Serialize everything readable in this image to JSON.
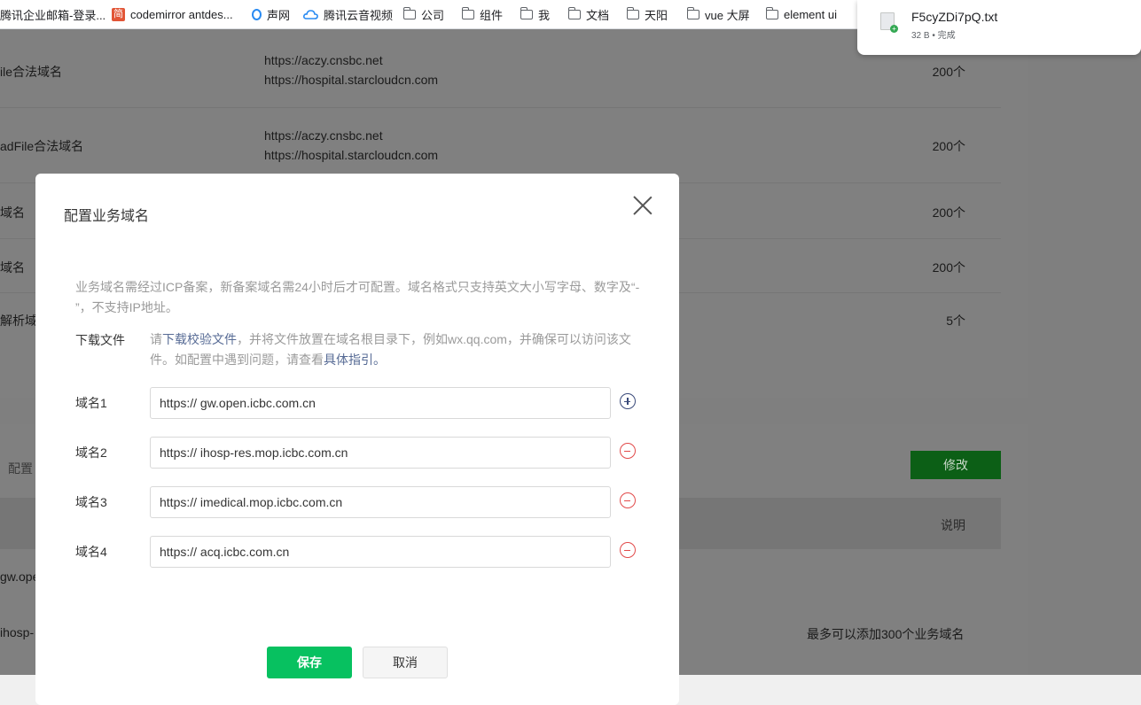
{
  "bookmarks": [
    {
      "label": "腾讯企业邮箱-登录...",
      "icon": "none"
    },
    {
      "label": "codemirror antdes...",
      "icon": "jian-icon"
    },
    {
      "label": "声网",
      "icon": "ring-icon"
    },
    {
      "label": "腾讯云音视频",
      "icon": "cloud-icon"
    },
    {
      "label": "公司",
      "icon": "folder-icon"
    },
    {
      "label": "组件",
      "icon": "folder-icon"
    },
    {
      "label": "我",
      "icon": "folder-icon"
    },
    {
      "label": "文档",
      "icon": "folder-icon"
    },
    {
      "label": "天阳",
      "icon": "folder-icon"
    },
    {
      "label": "vue 大屏",
      "icon": "folder-icon"
    },
    {
      "label": "element ui",
      "icon": "folder-icon"
    }
  ],
  "jian_char": "简",
  "download": {
    "filename": "F5cyZDi7pQ.txt",
    "meta": "32 B • 完成"
  },
  "background": {
    "rows": [
      {
        "label": "ile合法域名",
        "urls": [
          "https://aczy.cnsbc.net",
          "https://hospital.starcloudcn.com"
        ],
        "count": "200个"
      },
      {
        "label": "adFile合法域名",
        "urls": [
          "https://aczy.cnsbc.net",
          "https://hospital.starcloudcn.com"
        ],
        "count": "200个"
      },
      {
        "label": "域名",
        "urls": [],
        "count": "200个"
      },
      {
        "label": "域名",
        "urls": [],
        "count": "200个"
      },
      {
        "label": "解析域名",
        "urls": [],
        "count": "5个"
      }
    ],
    "config_label": "配置",
    "modify_label": "修改",
    "table_header": "说明",
    "cell1": "gw.ope",
    "cell2": "ihosp-",
    "max_note": "最多可以添加300个业务域名"
  },
  "modal": {
    "title": "配置业务域名",
    "notice": "业务域名需经过ICP备案，新备案域名需24小时后才可配置。域名格式只支持英文大小写字母、数字及“- ”，不支持IP地址。",
    "download_label": "下载文件",
    "download_desc_prefix": "请",
    "download_link": "下载校验文件",
    "download_desc_middle": "，并将文件放置在域名根目录下，例如wx.qq.com，并确保可以访问该文件。如配置中遇到问题，请查看",
    "guide_link": "具体指引",
    "download_desc_suffix": "。",
    "fields": [
      {
        "label": "域名1",
        "value": "https:// gw.open.icbc.com.cn",
        "action": "add"
      },
      {
        "label": "域名2",
        "value": "https:// ihosp-res.mop.icbc.com.cn",
        "action": "remove"
      },
      {
        "label": "域名3",
        "value": "https:// imedical.mop.icbc.com.cn",
        "action": "remove"
      },
      {
        "label": "域名4",
        "value": "https:// acq.icbc.com.cn",
        "action": "remove"
      }
    ],
    "save_label": "保存",
    "cancel_label": "取消"
  }
}
